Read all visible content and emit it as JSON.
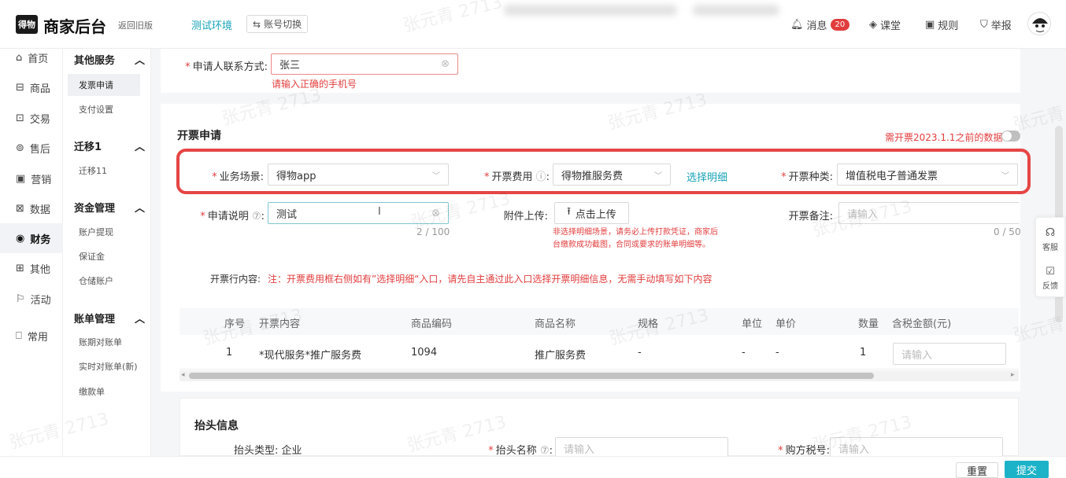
{
  "header": {
    "logo_text": "得物",
    "app_title": "商家后台",
    "back_old": "返回旧版",
    "env": "测试环境",
    "switch": "账号切换",
    "messages": "消息",
    "message_count": "20",
    "class": "课堂",
    "rules": "规则",
    "report": "举报"
  },
  "sidebar1": [
    {
      "icon": "home-icon",
      "label": "首页"
    },
    {
      "icon": "product-icon",
      "label": "商品"
    },
    {
      "icon": "trade-icon",
      "label": "交易"
    },
    {
      "icon": "after-sale-icon",
      "label": "售后"
    },
    {
      "icon": "marketing-icon",
      "label": "营销"
    },
    {
      "icon": "data-icon",
      "label": "数据"
    },
    {
      "icon": "finance-icon",
      "label": "财务"
    },
    {
      "icon": "other-icon",
      "label": "其他"
    },
    {
      "icon": "activity-icon",
      "label": "活动"
    },
    {
      "icon": "common-icon",
      "label": "常用"
    }
  ],
  "sidebar2": {
    "g1": "其他服务",
    "g1_items": [
      "发票申请",
      "支付设置"
    ],
    "g2": "迁移1",
    "g2_items": [
      "迁移11"
    ],
    "g3": "资金管理",
    "g3_items": [
      "账户提现",
      "保证金",
      "仓储账户"
    ],
    "g4": "账单管理",
    "g4_items": [
      "账期对账单",
      "实时对账单(新)",
      "缴款单"
    ]
  },
  "contact": {
    "label": "申请人联系方式:",
    "value": "张三",
    "error": "请输入正确的手机号"
  },
  "invoice": {
    "section_title": "开票申请",
    "old_data_label": "需开票2023.1.1之前的数据",
    "scene_label": "业务场景:",
    "scene_value": "得物app",
    "fee_label": "开票费用",
    "fee_value": "得物推服务费",
    "choose_detail": "选择明细",
    "kind_label": "开票种类:",
    "kind_value": "增值税电子普通发票",
    "desc_label": "申请说明",
    "desc_value": "测试",
    "desc_count": "2 / 100",
    "attach_label": "附件上传:",
    "upload_btn": "点击上传",
    "attach_note1": "非选择明细场景，请务必上传打款凭证，商家后",
    "attach_note2": "台缴款成功截图，合同或要求的账单明细等。",
    "remark_label": "开票备注:",
    "remark_placeholder": "请输入",
    "remark_count": "0 / 50",
    "content_label": "开票行内容:",
    "content_note": "注：开票费用框右侧如有”选择明细“入口，请先自主通过此入口选择开票明细信息，无需手动填写如下内容"
  },
  "table": {
    "headers": [
      "序号",
      "开票内容",
      "商品编码",
      "商品名称",
      "规格",
      "单位",
      "单价",
      "数量",
      "含税金额(元)"
    ],
    "row": {
      "no": "1",
      "content": "*现代服务*推广服务费",
      "code": "1094",
      "name": "推广服务费",
      "spec": "-",
      "unit": "-",
      "price": "-",
      "qty": "1",
      "amount_placeholder": "请输入"
    }
  },
  "header_info": {
    "title": "抬头信息",
    "type_label": "抬头类型:",
    "type_value": "企业",
    "name_label": "抬头名称",
    "name_placeholder": "请输入",
    "tax_label": "购方税号:",
    "tax_placeholder": "请输入"
  },
  "float": {
    "service": "客服",
    "feedback": "反馈"
  },
  "footer": {
    "reset": "重置",
    "submit": "提交"
  },
  "watermark": "张元青 2713"
}
